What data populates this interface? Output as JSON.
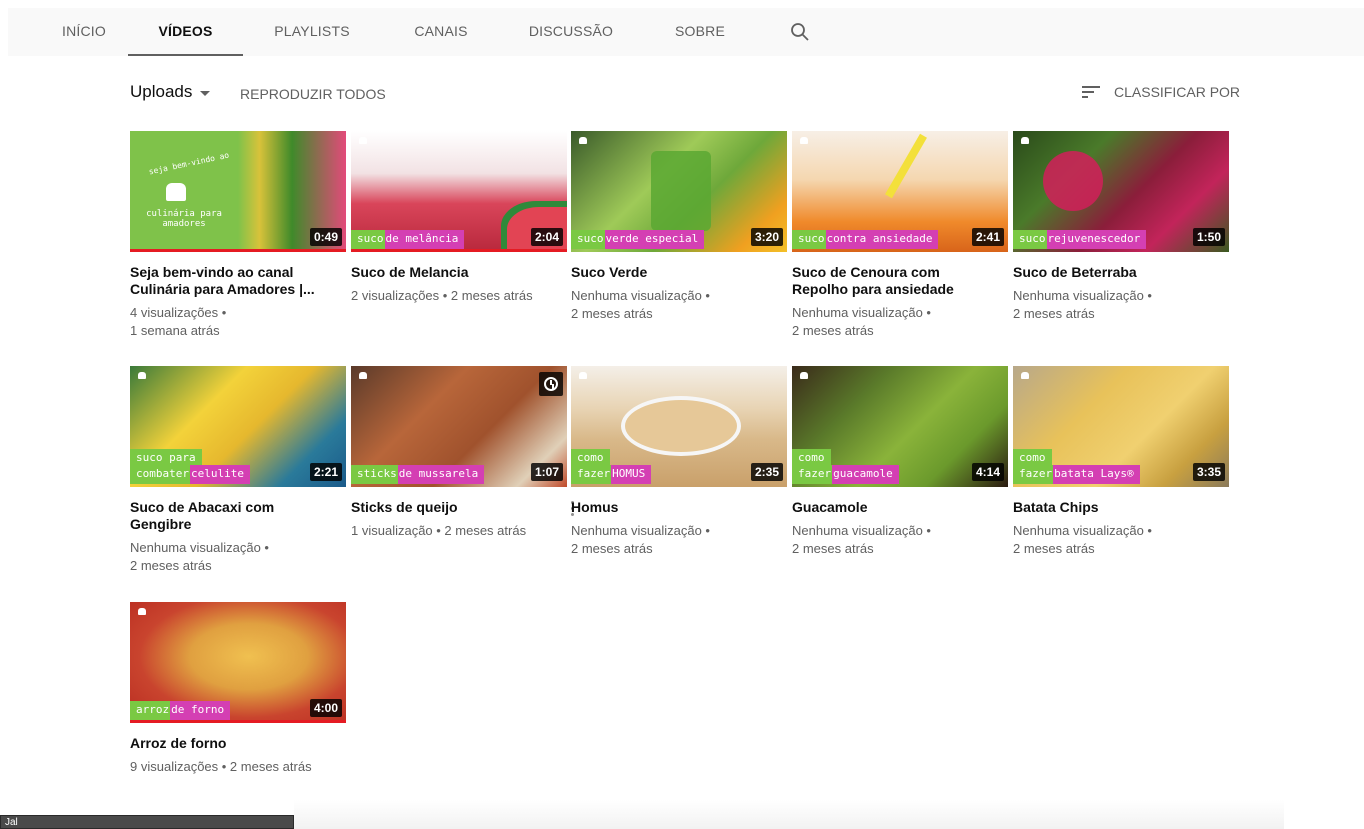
{
  "tabs": [
    {
      "label": "INÍCIO",
      "active": false
    },
    {
      "label": "VÍDEOS",
      "active": true
    },
    {
      "label": "PLAYLISTS",
      "active": false
    },
    {
      "label": "CANAIS",
      "active": false
    },
    {
      "label": "DISCUSSÃO",
      "active": false
    },
    {
      "label": "SOBRE",
      "active": false
    }
  ],
  "search_icon": "search-icon",
  "toolbar": {
    "uploads_label": "Uploads",
    "play_all_label": "REPRODUZIR TODOS",
    "sort_label": "CLASSIFICAR POR"
  },
  "videos": [
    {
      "title": "Seja bem-vindo ao canal Culinária para Amadores |...",
      "meta1": "4 visualizações •",
      "meta2": "1 semana atrás",
      "duration": "0:49",
      "thumb_color": "#7fc24a",
      "caption_green": "",
      "caption_magenta": "",
      "intro_text": [
        "seja bem-vindo ao",
        "culinária para amadores"
      ]
    },
    {
      "title": "Suco de Melancia",
      "meta1": "2 visualizações • 2 meses atrás",
      "meta2": "",
      "duration": "2:04",
      "thumb_color": "#d9455a",
      "caption_green": "suco",
      "caption_magenta": "de melância"
    },
    {
      "title": "Suco Verde",
      "meta1": "Nenhuma visualização •",
      "meta2": "2 meses atrás",
      "duration": "3:20",
      "thumb_color": "#6ea83a",
      "caption_green": "suco",
      "caption_magenta": "verde especial"
    },
    {
      "title": "Suco de Cenoura com Repolho para ansiedade",
      "meta1": "Nenhuma visualização •",
      "meta2": "2 meses atrás",
      "duration": "2:41",
      "thumb_color": "#f08a2b",
      "caption_green": "suco",
      "caption_magenta": "contra ansiedade"
    },
    {
      "title": "Suco de Beterraba",
      "meta1": "Nenhuma visualização •",
      "meta2": "2 meses atrás",
      "duration": "1:50",
      "thumb_color": "#8a1e3a",
      "caption_green": "suco",
      "caption_magenta": "rejuvenescedor"
    },
    {
      "title": "Suco de Abacaxi com Gengibre",
      "meta1": "Nenhuma visualização •",
      "meta2": "2 meses atrás",
      "duration": "2:21",
      "thumb_color": "#e6b82e",
      "caption_row1": "suco para",
      "caption_green": "combater",
      "caption_magenta": "celulite"
    },
    {
      "title": "Sticks de queijo",
      "meta1": "1 visualização • 2 meses atrás",
      "meta2": "",
      "duration": "1:07",
      "thumb_color": "#a0522d",
      "caption_green": "sticks",
      "caption_magenta": "de mussarela"
    },
    {
      "title": "Homus",
      "meta1": "Nenhuma visualização •",
      "meta2": "2 meses atrás",
      "duration": "2:35",
      "thumb_color": "#d9b98a",
      "caption_row1": "como",
      "caption_green": "fazer",
      "caption_magenta": "HOMUS"
    },
    {
      "title": "Guacamole",
      "meta1": "Nenhuma visualização •",
      "meta2": "2 meses atrás",
      "duration": "4:14",
      "thumb_color": "#6b9a2c",
      "caption_row1": "como",
      "caption_green": "fazer",
      "caption_magenta": "guacamole"
    },
    {
      "title": "Batata Chips",
      "meta1": "Nenhuma visualização •",
      "meta2": "2 meses atrás",
      "duration": "3:35",
      "thumb_color": "#e8c25a",
      "caption_row1": "como",
      "caption_green": "fazer",
      "caption_magenta": "batata Lays®"
    },
    {
      "title": "Arroz de forno",
      "meta1": "9 visualizações • 2 meses atrás",
      "meta2": "",
      "duration": "4:00",
      "thumb_color": "#c9442e",
      "caption_green": "arroz",
      "caption_magenta": "de forno"
    }
  ],
  "bottom_bar_text": "Jal",
  "colors": {
    "accent_red": "#e51b23",
    "caption_green": "#7ac943",
    "caption_magenta": "#d43fb3"
  }
}
